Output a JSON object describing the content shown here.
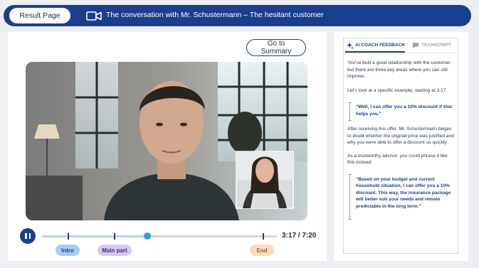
{
  "header": {
    "result_button": "Result Page",
    "title": "The conversation with Mr. Schustermann – The hesitant customer"
  },
  "main": {
    "summary_button": "Go to Summary"
  },
  "player": {
    "time": "3:17 / 7:20",
    "progress": 0.447,
    "chapters": [
      {
        "label": "Intro",
        "color": "#a9ccf3",
        "text_color": "#1a3f8f"
      },
      {
        "label": "Main part",
        "color": "#d7c8f3",
        "text_color": "#3a2a7a"
      },
      {
        "label": "End",
        "color": "#f9dcc0",
        "text_color": "#b0641e"
      }
    ]
  },
  "sidebar": {
    "tabs": [
      {
        "label": "AI COACH FEEDBACK",
        "icon": "sparkle-icon",
        "active": true
      },
      {
        "label": "TRANSCRIPT",
        "icon": "chat-icon",
        "active": false
      }
    ],
    "paragraph1": "You've built a good relationship with the customer, but there are three key areas where you can still improve.",
    "paragraph2": "Let's look at a specific example, starting at 3:17:",
    "quote1": "\"Well, I can offer you a 10% discount if that helps you.\"",
    "paragraph3": "After receiving this offer, Mr. Schustermann began to doubt whether the original price was justified and why you were able to offer a discount so quickly.",
    "paragraph4": "As a trustworthy advisor, you could phrase it like this instead:",
    "quote2": "\"Based on your budget and current household situation, I can offer you a 10% discount. This way, the insurance package will better suit your needs and remain predictable in the long term.\""
  },
  "colors": {
    "brand": "#1a3f8f",
    "accent": "#2a9df4",
    "background": "#eeeff3"
  }
}
